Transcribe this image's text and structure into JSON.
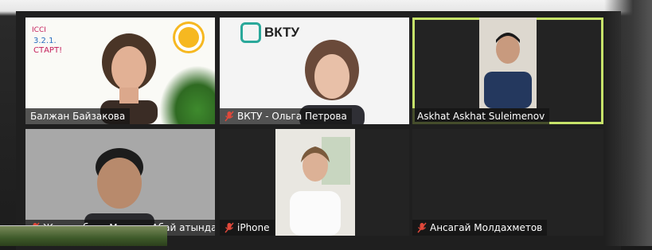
{
  "participants": [
    {
      "name": "Балжан Байзакова",
      "muted": false,
      "active": false
    },
    {
      "name": "ВКТУ - Ольга Петрова",
      "muted": true,
      "active": false
    },
    {
      "name": "Askhat Askhat Suleimenov",
      "muted": false,
      "active": true
    },
    {
      "name": "Жолдасбаев Мауыен Абай атында...",
      "muted": true,
      "active": false
    },
    {
      "name": "iPhone",
      "muted": true,
      "active": false
    },
    {
      "name": "Ансагай Молдахметов",
      "muted": true,
      "active": false
    }
  ],
  "backgrounds": {
    "tile2_brand": "ВКТУ",
    "tile1_logo_text": "3.2.1 СТАРТ!"
  },
  "colors": {
    "active_speaker_border": "#c7e36a",
    "muted_mic": "#e0483a",
    "brand_teal": "#2aa89a"
  },
  "icons": [
    "mic-muted-icon"
  ]
}
